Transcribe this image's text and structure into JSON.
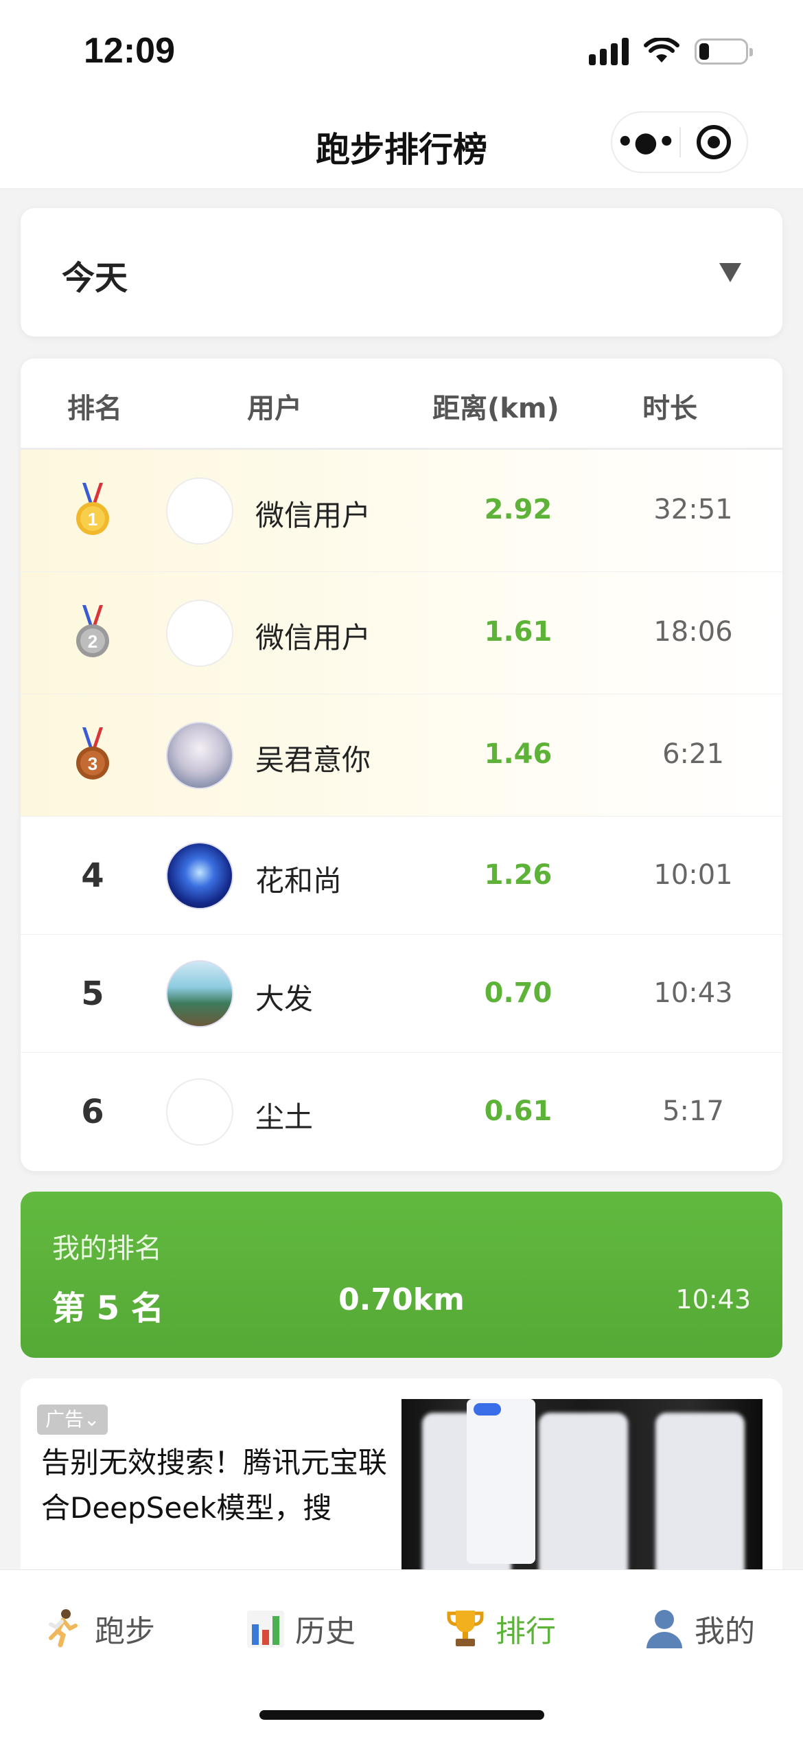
{
  "status_bar": {
    "time": "12:09"
  },
  "nav": {
    "title": "跑步排行榜",
    "more_icon": "more-dots-icon",
    "close_icon": "target-circle-icon"
  },
  "date_filter": {
    "selected": "今天"
  },
  "table": {
    "headers": {
      "rank": "排名",
      "user": "用户",
      "distance": "距离(km)",
      "duration": "时长"
    },
    "rows": [
      {
        "rank": "1",
        "medal": "gold",
        "name": "微信用户",
        "distance": "2.92",
        "duration": "32:51",
        "avatar": "blank"
      },
      {
        "rank": "2",
        "medal": "silver",
        "name": "微信用户",
        "distance": "1.61",
        "duration": "18:06",
        "avatar": "blank"
      },
      {
        "rank": "3",
        "medal": "bronze",
        "name": "吴君意你",
        "distance": "1.46",
        "duration": "6:21",
        "avatar": "anime-girl-photo"
      },
      {
        "rank": "4",
        "name": "花和尚",
        "distance": "1.26",
        "duration": "10:01",
        "avatar": "city-night-photo"
      },
      {
        "rank": "5",
        "name": "大发",
        "distance": "0.70",
        "duration": "10:43",
        "avatar": "seaside-person-photo"
      },
      {
        "rank": "6",
        "name": "尘土",
        "distance": "0.61",
        "duration": "5:17",
        "avatar": "blank"
      }
    ]
  },
  "my_rank": {
    "title": "我的排名",
    "rank": "第 5 名",
    "distance": "0.70km",
    "duration": "10:43"
  },
  "ad": {
    "badge": "广告⌄",
    "text": "告别无效搜索！腾讯元宝联合DeepSeek模型，搜"
  },
  "tabs": [
    {
      "label": "跑步",
      "icon": "runner-icon",
      "active": false
    },
    {
      "label": "历史",
      "icon": "bar-chart-icon",
      "active": false
    },
    {
      "label": "排行",
      "icon": "trophy-icon",
      "active": true
    },
    {
      "label": "我的",
      "icon": "user-icon",
      "active": false
    }
  ],
  "colors": {
    "accent": "#5cb338",
    "gold": "#f0b82a",
    "silver": "#a9a9a9",
    "bronze": "#b5652e"
  }
}
